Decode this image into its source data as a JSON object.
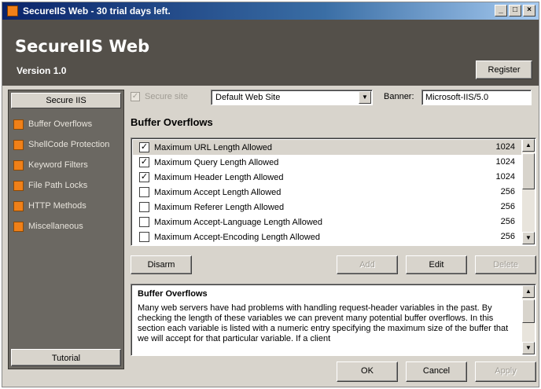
{
  "window": {
    "title": "SecureIIS Web - 30 trial days left.",
    "controls": [
      "_",
      "□",
      "×"
    ]
  },
  "header": {
    "app_title": "SecureIIS Web",
    "version": "Version 1.0",
    "register_label": "Register"
  },
  "sidebar": {
    "heading": "Secure IIS",
    "items": [
      {
        "label": "Buffer Overflows"
      },
      {
        "label": "ShellCode Protection"
      },
      {
        "label": "Keyword Filters"
      },
      {
        "label": "File Path Locks"
      },
      {
        "label": "HTTP Methods"
      },
      {
        "label": "Miscellaneous"
      }
    ],
    "tutorial_label": "Tutorial"
  },
  "toolbar": {
    "secure_site_label": "Secure site",
    "site_value": "Default Web Site",
    "banner_label": "Banner:",
    "banner_value": "Microsoft-IIS/5.0"
  },
  "main": {
    "section_title": "Buffer Overflows",
    "rows": [
      {
        "label": "Maximum URL Length Allowed",
        "value": "1024",
        "checked": true
      },
      {
        "label": "Maximum Query Length Allowed",
        "value": "1024",
        "checked": true
      },
      {
        "label": "Maximum Header Length Allowed",
        "value": "1024",
        "checked": true
      },
      {
        "label": "Maximum Accept Length Allowed",
        "value": "256",
        "checked": false
      },
      {
        "label": "Maximum Referer Length Allowed",
        "value": "256",
        "checked": false
      },
      {
        "label": "Maximum Accept-Language Length Allowed",
        "value": "256",
        "checked": false
      },
      {
        "label": "Maximum Accept-Encoding Length Allowed",
        "value": "256",
        "checked": false
      }
    ],
    "buttons": {
      "disarm": "Disarm",
      "add": "Add",
      "edit": "Edit",
      "delete": "Delete"
    },
    "description": {
      "title": "Buffer Overflows",
      "body": "Many web servers have had problems with handling request-header variables in the past. By checking the length of these variables we can prevent many potential buffer overflows. In this section each variable is listed with a numeric entry specifying the maximum size of the buffer that we will accept for that particular variable. If a client"
    }
  },
  "footer": {
    "ok": "OK",
    "cancel": "Cancel",
    "apply": "Apply"
  },
  "colors": {
    "title_bar": "#0a246a",
    "header_band": "#54504a",
    "sidebar": "#6b6862",
    "item_marker": "#f08018",
    "face": "#d8d4cc"
  }
}
